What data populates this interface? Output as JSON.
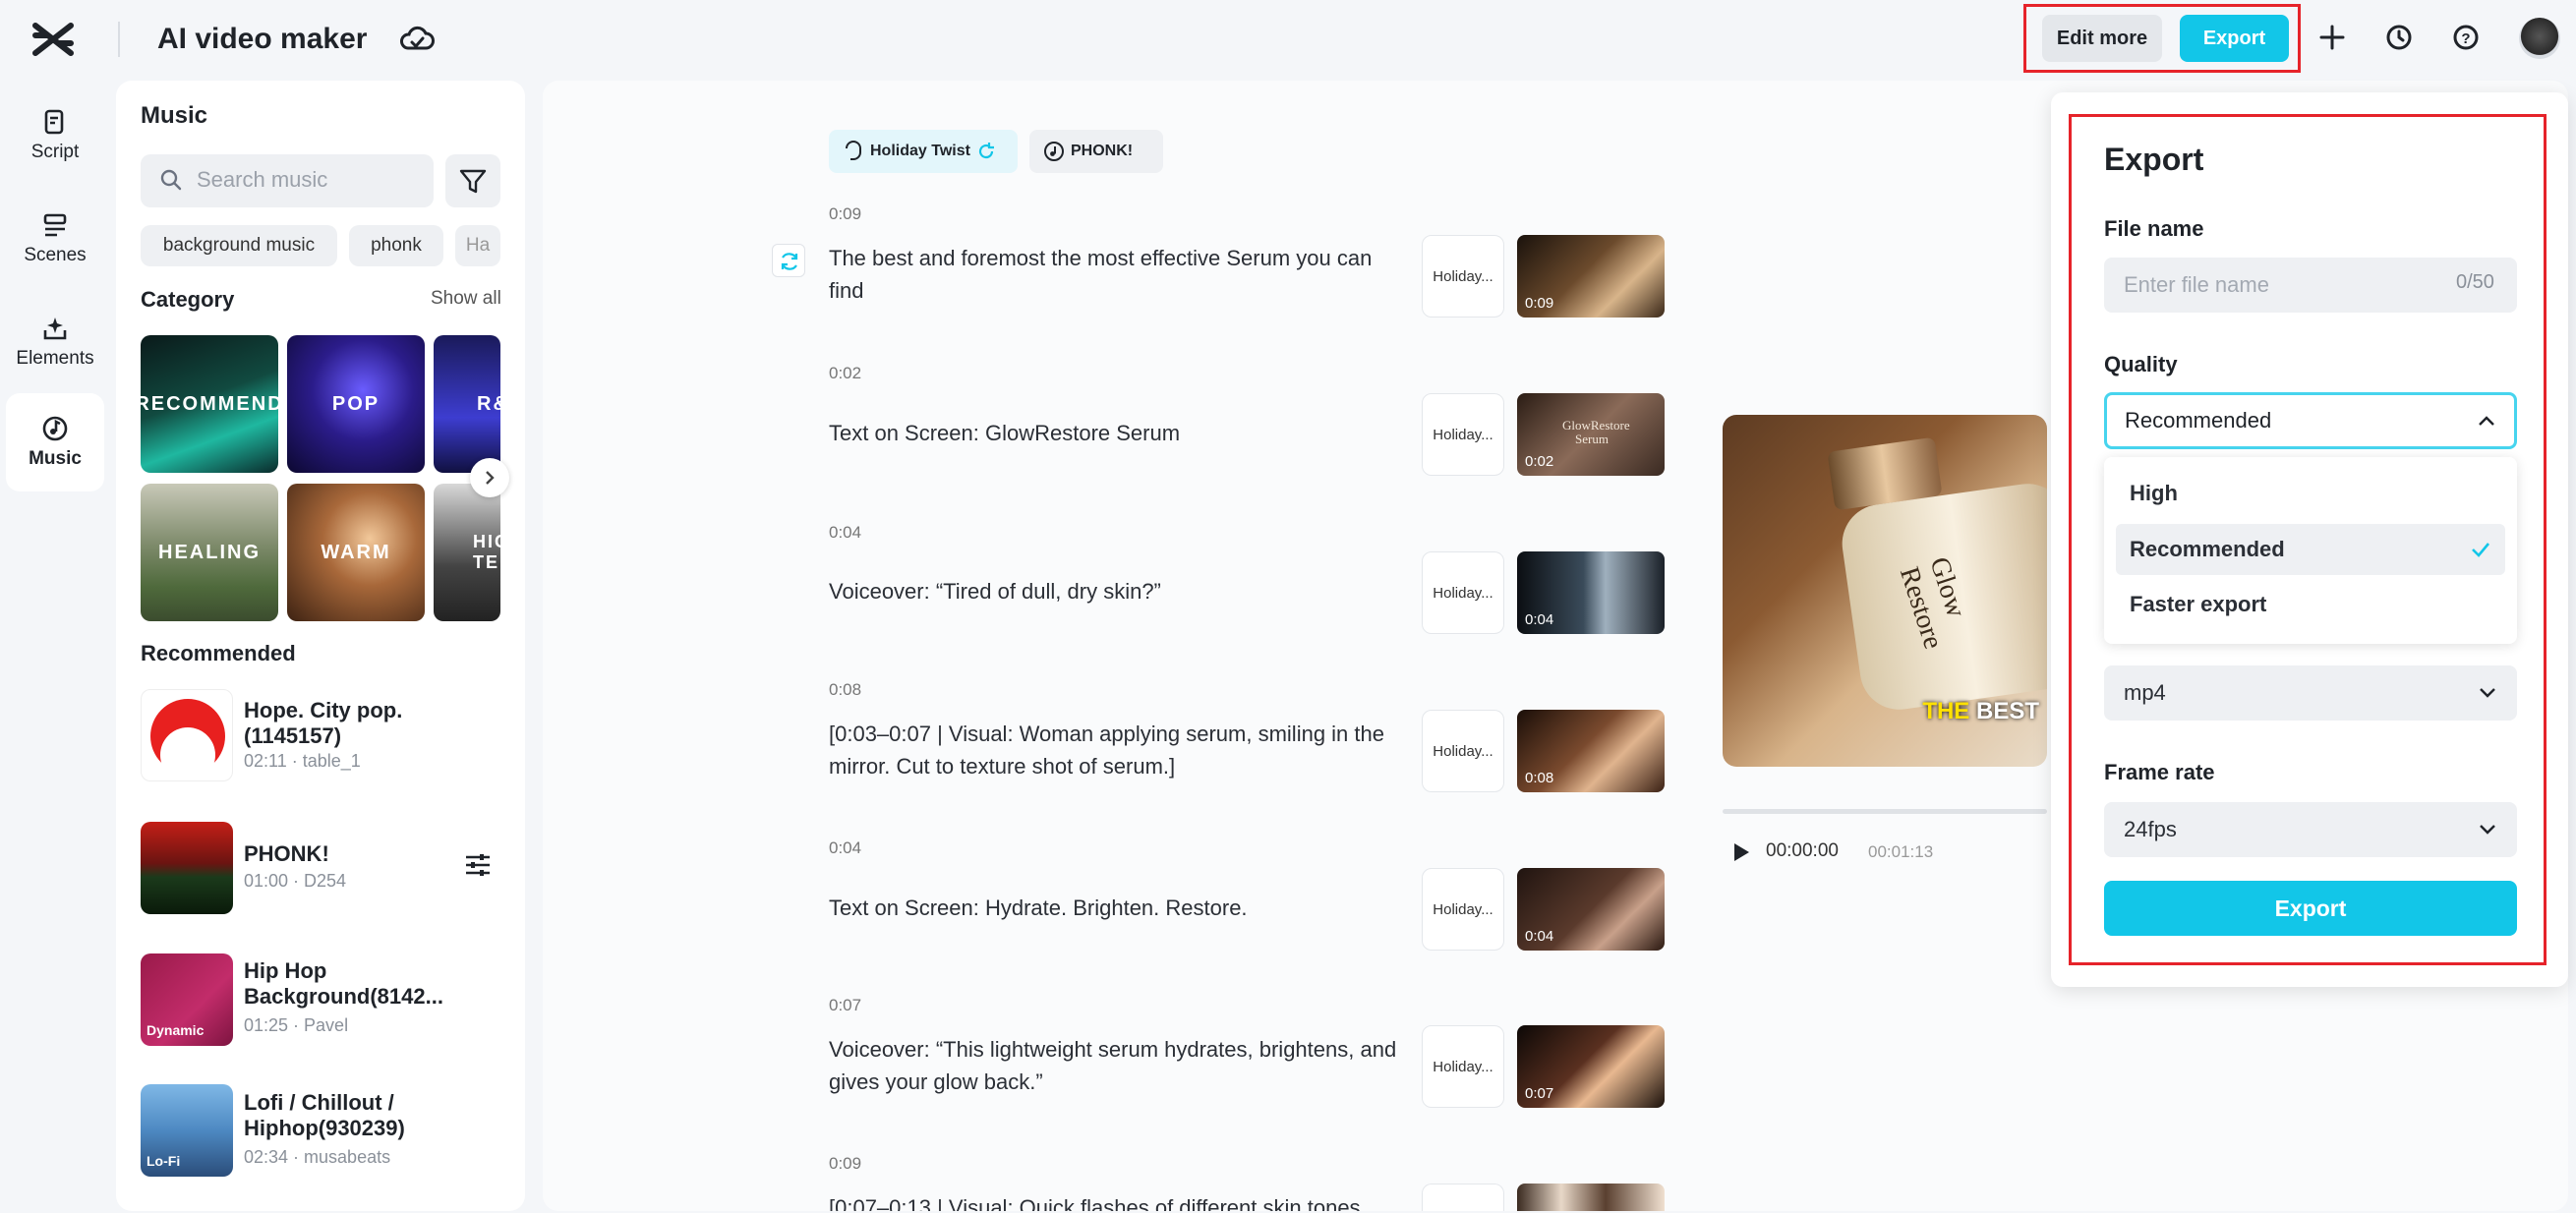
{
  "app": {
    "title": "AI video maker"
  },
  "toolbar": {
    "edit_more": "Edit more",
    "export": "Export"
  },
  "rail": [
    {
      "label": "Script"
    },
    {
      "label": "Scenes"
    },
    {
      "label": "Elements"
    },
    {
      "label": "Music"
    }
  ],
  "music": {
    "title": "Music",
    "search_placeholder": "Search music",
    "chips": [
      "background music",
      "phonk",
      "Ha"
    ],
    "category_label": "Category",
    "show_all": "Show all",
    "categories": [
      "RECOMMEND",
      "POP",
      "R&",
      "HEALING",
      "WARM",
      "HIG TEM"
    ],
    "recommended_label": "Recommended",
    "tracks": [
      {
        "title": "Hope. City pop. (1145157)",
        "meta": "02:11 · table_1"
      },
      {
        "title": "PHONK!",
        "meta": "01:00 · D254"
      },
      {
        "title": "Hip Hop Background(8142...",
        "meta": "01:25 · Pavel",
        "badge": "Dynamic"
      },
      {
        "title": "Lofi / Chillout / Hiphop(930239)",
        "meta": "02:34 · musabeats",
        "badge": "Lo-Fi"
      }
    ]
  },
  "script": {
    "style_chips": [
      "Holiday Twist",
      "PHONK!"
    ],
    "music_thumb_label": "Holiday...",
    "scenes": [
      {
        "time": "0:09",
        "text": "The best and foremost the most effective Serum you can find",
        "thumb_time": "0:09"
      },
      {
        "time": "0:02",
        "text": "Text on Screen: GlowRestore Serum",
        "thumb_time": "0:02",
        "thumb_text": "GlowRestore Serum"
      },
      {
        "time": "0:04",
        "text": "Voiceover: “Tired of dull, dry skin?”",
        "thumb_time": "0:04"
      },
      {
        "time": "0:08",
        "text": "[0:03–0:07 | Visual: Woman applying serum, smiling in the mirror. Cut to texture shot of serum.]",
        "thumb_time": "0:08"
      },
      {
        "time": "0:04",
        "text": "Text on Screen: Hydrate. Brighten. Restore.",
        "thumb_time": "0:04"
      },
      {
        "time": "0:07",
        "text": "Voiceover: “This lightweight serum hydrates, brightens, and gives your glow back.”",
        "thumb_time": "0:07"
      },
      {
        "time": "0:09",
        "text": "[0:07–0:13 | Visual: Quick flashes of different skin tones",
        "thumb_time": ""
      }
    ]
  },
  "preview": {
    "bottle_text": "Glow Restore",
    "caption_highlight": "THE",
    "caption_rest": " BEST",
    "current_time": "00:00:00",
    "total_time": "00:01:13",
    "progress": 0
  },
  "export_panel": {
    "title": "Export",
    "file_name_label": "File name",
    "file_name_placeholder": "Enter file name",
    "file_name_value": "",
    "file_name_count": "0/50",
    "quality_label": "Quality",
    "quality_selected": "Recommended",
    "quality_options": [
      "High",
      "Recommended",
      "Faster export"
    ],
    "format_value": "mp4",
    "frame_rate_label": "Frame rate",
    "frame_rate_value": "24fps",
    "export_button": "Export"
  },
  "colors": {
    "accent": "#12c6e8",
    "highlight": "#e6232a",
    "focus": "#47d4ee"
  }
}
